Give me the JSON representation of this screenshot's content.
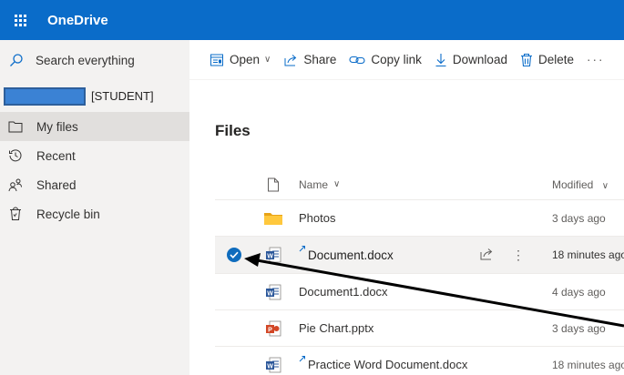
{
  "app": {
    "title": "OneDrive"
  },
  "sidebar": {
    "search_label": "Search everything",
    "user_label": "[STUDENT]",
    "items": [
      {
        "label": "My files",
        "icon": "folder-icon",
        "active": true
      },
      {
        "label": "Recent",
        "icon": "clock-icon",
        "active": false
      },
      {
        "label": "Shared",
        "icon": "people-icon",
        "active": false
      },
      {
        "label": "Recycle bin",
        "icon": "trash-icon",
        "active": false
      }
    ]
  },
  "toolbar": {
    "open": "Open",
    "share": "Share",
    "copy_link": "Copy link",
    "download": "Download",
    "delete": "Delete",
    "more": "···"
  },
  "main": {
    "title": "Files",
    "columns": {
      "name": "Name",
      "modified": "Modified"
    },
    "files": [
      {
        "name": "Photos",
        "type": "folder",
        "modified": "3 days ago",
        "is_new": false,
        "selected": false
      },
      {
        "name": "Document.docx",
        "type": "word",
        "modified": "18 minutes ago",
        "is_new": true,
        "selected": true
      },
      {
        "name": "Document1.docx",
        "type": "word",
        "modified": "4 days ago",
        "is_new": false,
        "selected": false
      },
      {
        "name": "Pie Chart.pptx",
        "type": "powerpoint",
        "modified": "3 days ago",
        "is_new": false,
        "selected": false
      },
      {
        "name": "Practice Word Document.docx",
        "type": "word",
        "modified": "18 minutes ago",
        "is_new": true,
        "selected": false
      }
    ]
  },
  "colors": {
    "brand": "#0a6cc9",
    "sidebar_bg": "#f3f2f1",
    "selected_check": "#0f6cbd",
    "folder": "#ffb900",
    "word": "#2b579a",
    "powerpoint": "#d24726"
  }
}
